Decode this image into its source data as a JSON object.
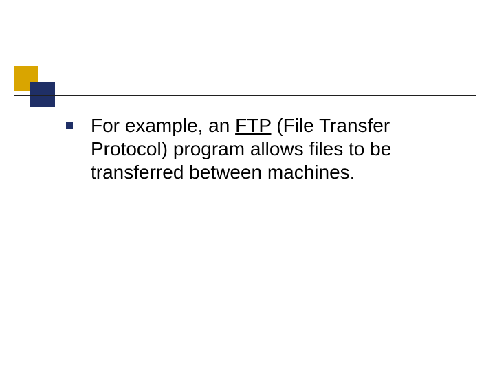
{
  "slide": {
    "bullet_text_before": "For example, an ",
    "bullet_ftp": "FTP",
    "bullet_text_after": " (File Transfer Protocol) program allows files to be transferred between machines."
  },
  "colors": {
    "accent_gold": "#d9a500",
    "accent_navy": "#1f2f66"
  }
}
